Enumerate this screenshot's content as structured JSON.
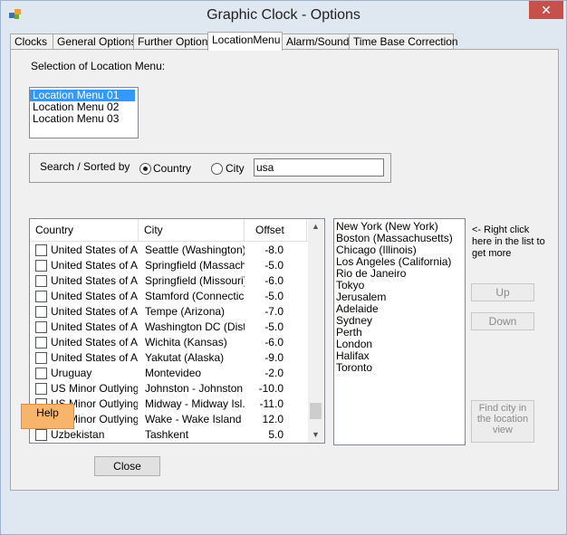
{
  "window": {
    "title": "Graphic Clock - Options",
    "close_label": "✕"
  },
  "tabs": [
    {
      "label": "Clocks"
    },
    {
      "label": "General Options"
    },
    {
      "label": "Further Options"
    },
    {
      "label": "LocationMenu"
    },
    {
      "label": "Alarm/Sound"
    },
    {
      "label": "Time Base Correction"
    }
  ],
  "location_menu": {
    "label": "Selection of Location Menu:",
    "items": [
      "Location Menu 01",
      "Location Menu 02",
      "Location Menu 03"
    ],
    "selected_index": 0
  },
  "search": {
    "label": "Search / Sorted by",
    "option_country": "Country",
    "option_city": "City",
    "selected": "country",
    "value": "usa"
  },
  "grid": {
    "headers": [
      "Country",
      "City",
      "Offset"
    ],
    "rows": [
      {
        "country": "United States of A...",
        "city": "Seattle (Washington)",
        "offset": "-8.0"
      },
      {
        "country": "United States of A...",
        "city": "Springfield (Massach...",
        "offset": "-5.0"
      },
      {
        "country": "United States of A...",
        "city": "Springfield (Missouri)",
        "offset": "-6.0"
      },
      {
        "country": "United States of A...",
        "city": "Stamford (Connecticut)",
        "offset": "-5.0"
      },
      {
        "country": "United States of A...",
        "city": "Tempe (Arizona)",
        "offset": "-7.0"
      },
      {
        "country": "United States of A...",
        "city": "Washington DC (Dist...",
        "offset": "-5.0"
      },
      {
        "country": "United States of A...",
        "city": "Wichita (Kansas)",
        "offset": "-6.0"
      },
      {
        "country": "United States of A...",
        "city": "Yakutat (Alaska)",
        "offset": "-9.0"
      },
      {
        "country": "Uruguay",
        "city": "Montevideo",
        "offset": "-2.0"
      },
      {
        "country": "US Minor Outlying...",
        "city": "Johnston - Johnston ...",
        "offset": "-10.0"
      },
      {
        "country": "US Minor Outlying...",
        "city": "Midway - Midway Isl...",
        "offset": "-11.0"
      },
      {
        "country": "US Minor Outlying...",
        "city": "Wake - Wake Island",
        "offset": "12.0"
      },
      {
        "country": "Uzbekistan",
        "city": "Tashkent",
        "offset": "5.0"
      }
    ]
  },
  "location_view": {
    "items": [
      "New York (New York)",
      "Boston (Massachusetts)",
      "Chicago (Illinois)",
      "Los Angeles (California)",
      "Rio de Janeiro",
      "Tokyo",
      "Jerusalem",
      "Adelaide",
      "Sydney",
      "Perth",
      "London",
      "Halifax",
      "Toronto"
    ]
  },
  "hint": {
    "line1": "<- Right click",
    "line2": "here in the list to",
    "line3": "get more"
  },
  "buttons": {
    "up": "Up",
    "down": "Down",
    "find_line1": "Find city in",
    "find_line2": "the location",
    "find_line3": "view",
    "help": "Help",
    "close": "Close"
  },
  "colors": {
    "selection": "#3399ff",
    "help_button": "#f8b46b",
    "close_button": "#c7504a"
  }
}
